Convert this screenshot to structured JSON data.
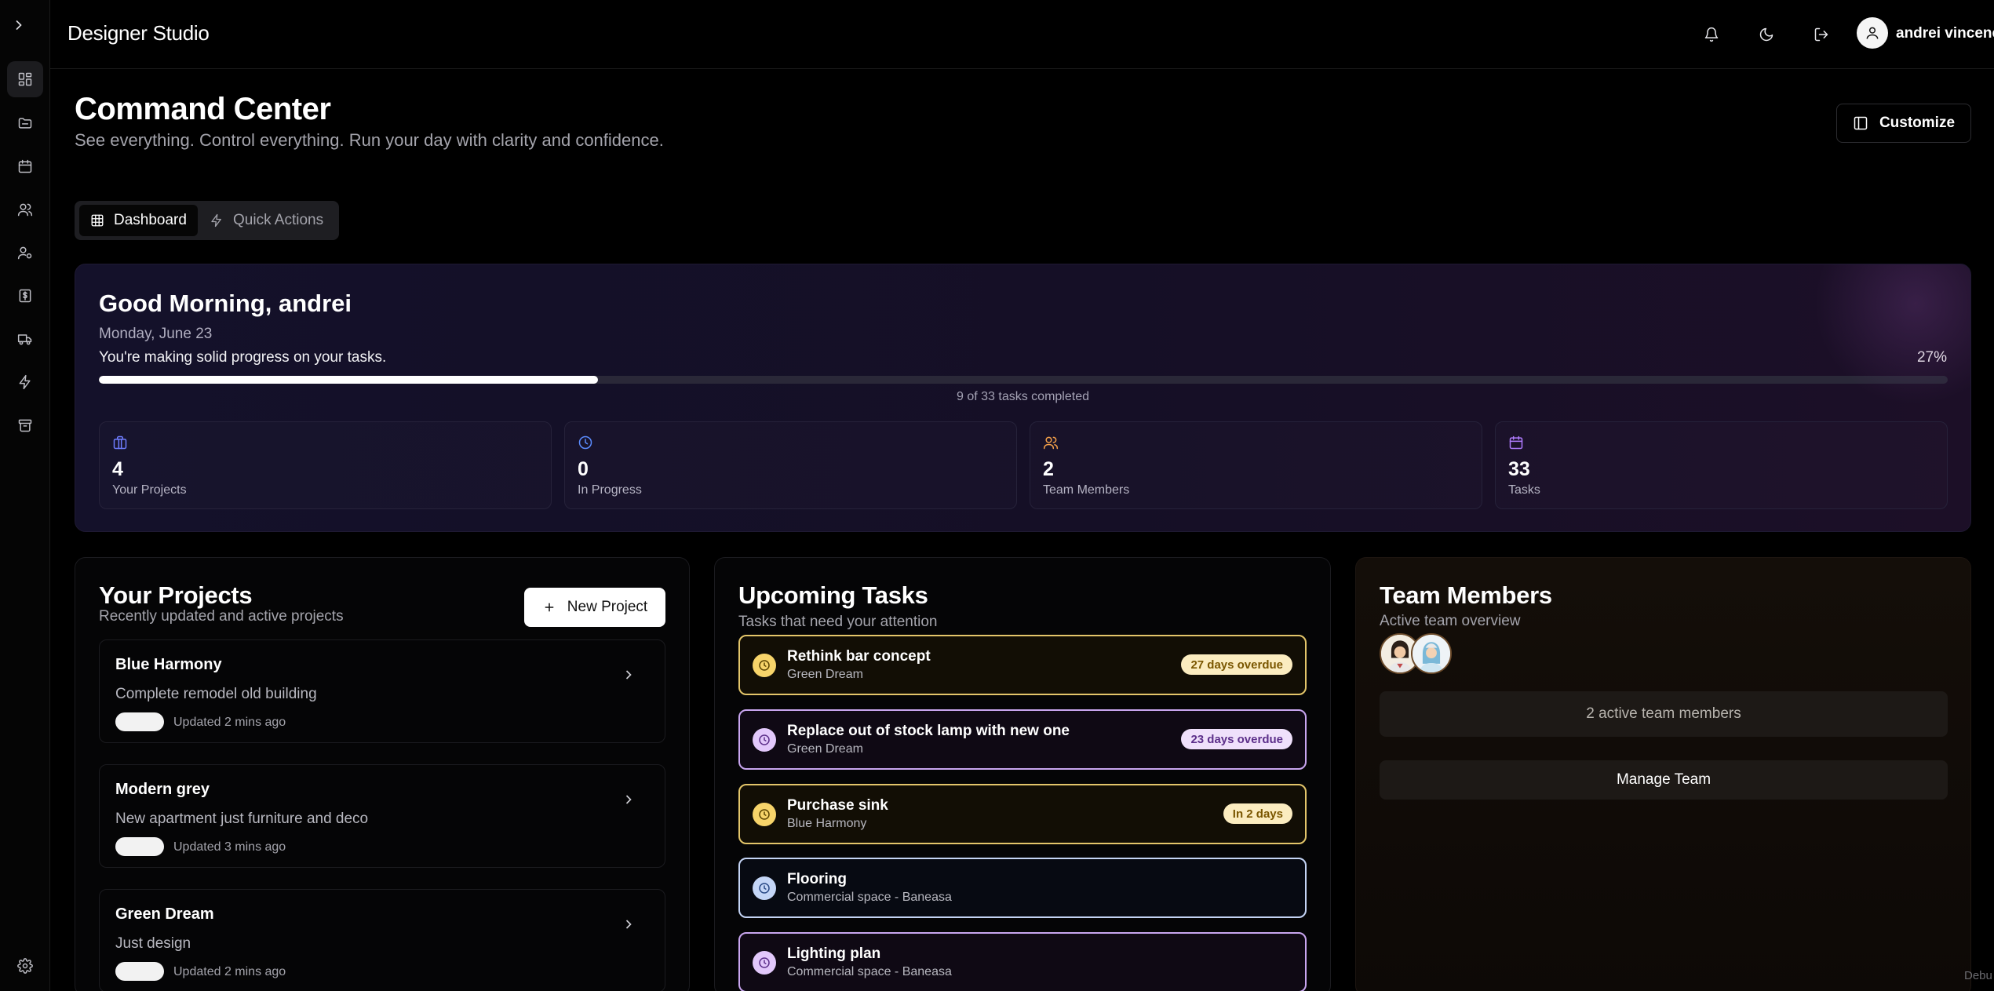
{
  "app": {
    "brand": "Designer Studio"
  },
  "user": {
    "name": "andrei vincene"
  },
  "header": {
    "title": "Command Center",
    "subtitle": "See everything. Control everything. Run your day with clarity and confidence.",
    "customize_label": "Customize"
  },
  "tabs": [
    {
      "label": "Dashboard",
      "active": true
    },
    {
      "label": "Quick Actions",
      "active": false
    }
  ],
  "sidebar": {
    "icons": [
      "dashboard-icon",
      "folder-icon",
      "calendar-icon",
      "users-icon",
      "user-settings-icon",
      "invoice-icon",
      "truck-icon",
      "lightning-icon",
      "archive-icon",
      "gear-icon"
    ]
  },
  "welcome": {
    "greeting": "Good Morning, andrei",
    "date": "Monday, June 23",
    "progress_message": "You're making solid progress on your tasks.",
    "progress_percent_label": "27%",
    "progress_fraction": 0.27,
    "progress_count": "9 of 33 tasks completed",
    "stats": [
      {
        "value": "4",
        "label": "Your Projects",
        "icon": "briefcase-icon",
        "color": "#6f7dff"
      },
      {
        "value": "0",
        "label": "In Progress",
        "icon": "clock-icon",
        "color": "#5b8cff"
      },
      {
        "value": "2",
        "label": "Team Members",
        "icon": "users-icon",
        "color": "#f5a14a"
      },
      {
        "value": "33",
        "label": "Tasks",
        "icon": "calendar-icon",
        "color": "#b07cff"
      }
    ]
  },
  "projects": {
    "title": "Your Projects",
    "subtitle": "Recently updated and active projects",
    "new_button": "New Project",
    "items": [
      {
        "name": "Blue Harmony",
        "description": "Complete remodel old building",
        "updated": "Updated 2 mins ago"
      },
      {
        "name": "Modern grey",
        "description": "New apartment just furniture and deco",
        "updated": "Updated 3 mins ago"
      },
      {
        "name": "Green Dream",
        "description": "Just design",
        "updated": "Updated 2 mins ago"
      }
    ]
  },
  "tasks": {
    "title": "Upcoming Tasks",
    "subtitle": "Tasks that need your attention",
    "items": [
      {
        "name": "Rethink bar concept",
        "project": "Green Dream",
        "badge": "27 days overdue",
        "theme": "yellow"
      },
      {
        "name": "Replace out of stock lamp with new one",
        "project": "Green Dream",
        "badge": "23 days overdue",
        "theme": "purple"
      },
      {
        "name": "Purchase sink",
        "project": "Blue Harmony",
        "badge": "In 2 days",
        "theme": "yellow"
      },
      {
        "name": "Flooring",
        "project": "Commercial space - Baneasa",
        "badge": "",
        "theme": "blue"
      },
      {
        "name": "Lighting plan",
        "project": "Commercial space - Baneasa",
        "badge": "",
        "theme": "purple"
      }
    ]
  },
  "team": {
    "title": "Team Members",
    "subtitle": "Active team overview",
    "active_text": "2 active team members",
    "manage_button": "Manage Team"
  },
  "footer": {
    "debug_label": "Debu"
  },
  "colors": {
    "yellow_border": "#e3c56a",
    "purple_border": "#c9a6f0",
    "blue_border": "#c4d4f5"
  }
}
